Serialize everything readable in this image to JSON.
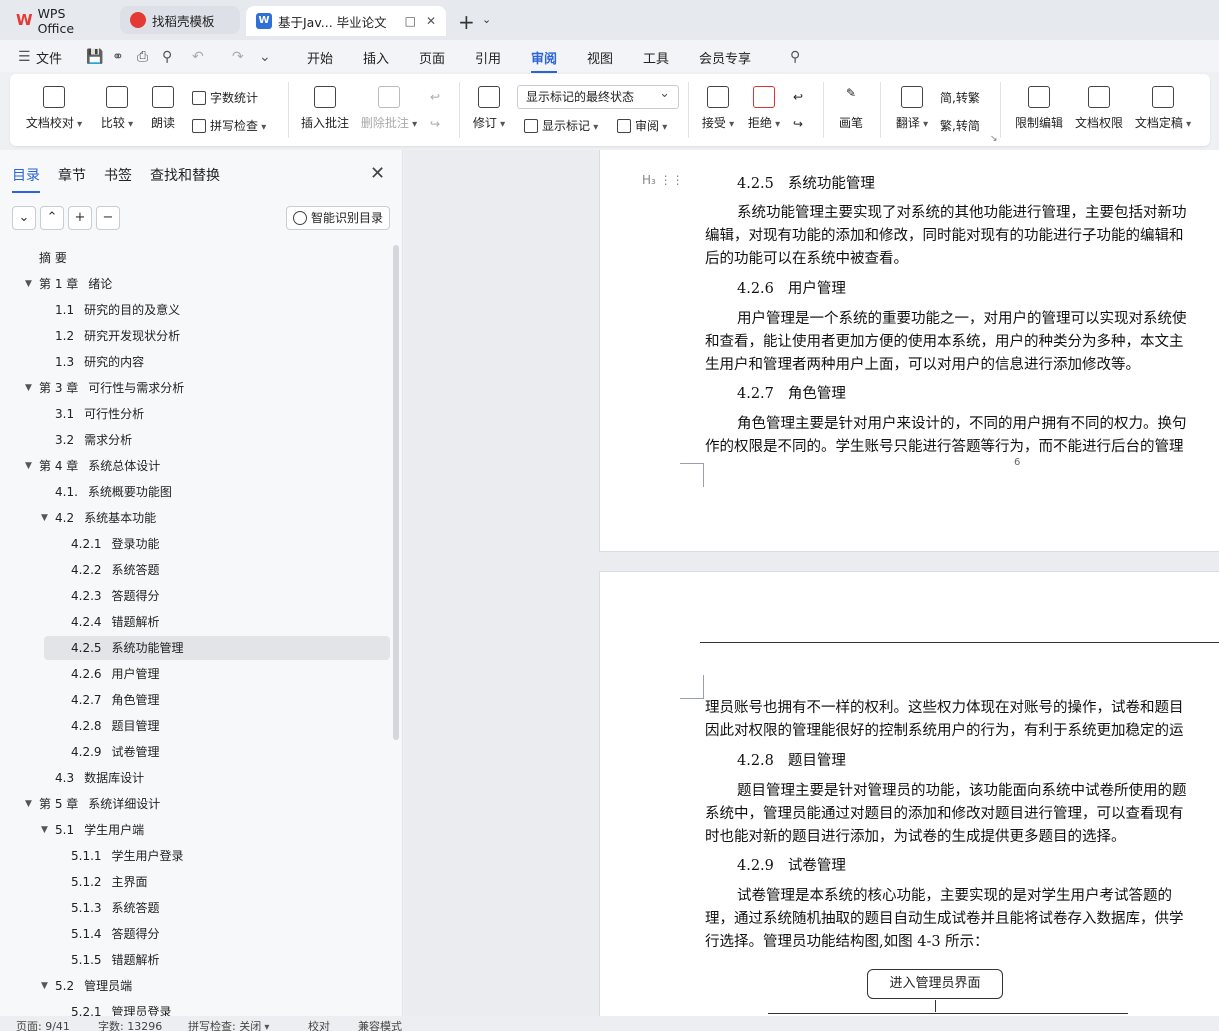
{
  "tabs": {
    "wps": "WPS Office",
    "template": "找稻壳模板",
    "doc": "基于Jav... 毕业论文"
  },
  "menu": {
    "file": "文件",
    "items": [
      "开始",
      "插入",
      "页面",
      "引用",
      "审阅",
      "视图",
      "工具",
      "会员专享"
    ],
    "active": "审阅"
  },
  "ribbon": {
    "doc_check": "文档校对",
    "compare": "比较",
    "read_aloud": "朗读",
    "word_count": "字数统计",
    "spell_check": "拼写检查",
    "insert_comment": "插入批注",
    "delete_comment": "删除批注",
    "revise": "修订",
    "markup_state": "显示标记的最终状态",
    "show_markup": "显示标记",
    "review": "审阅",
    "accept": "接受",
    "reject": "拒绝",
    "pen": "画笔",
    "translate": "翻译",
    "to_traditional": "简,转繁",
    "to_simplified": "繁,转简",
    "restrict_edit": "限制编辑",
    "doc_permission": "文档权限",
    "finalize": "文档定稿"
  },
  "sidebar": {
    "tabs": [
      "目录",
      "章节",
      "书签",
      "查找和替换"
    ],
    "smart_toc": "智能识别目录",
    "toc": [
      {
        "num": "",
        "label": "摘 要"
      },
      {
        "num": "第 1 章",
        "label": "绪论"
      },
      {
        "num": "1.1",
        "label": "研究的目的及意义"
      },
      {
        "num": "1.2",
        "label": "研究开发现状分析"
      },
      {
        "num": "1.3",
        "label": "研究的内容"
      },
      {
        "num": "第 3 章",
        "label": "可行性与需求分析"
      },
      {
        "num": "3.1",
        "label": "可行性分析"
      },
      {
        "num": "3.2",
        "label": "需求分析"
      },
      {
        "num": "第 4 章",
        "label": "系统总体设计"
      },
      {
        "num": "4.1.",
        "label": "系统概要功能图"
      },
      {
        "num": "4.2",
        "label": "系统基本功能"
      },
      {
        "num": "4.2.1",
        "label": "登录功能"
      },
      {
        "num": "4.2.2",
        "label": "系统答题"
      },
      {
        "num": "4.2.3",
        "label": "答题得分"
      },
      {
        "num": "4.2.4",
        "label": "错题解析"
      },
      {
        "num": "4.2.5",
        "label": "系统功能管理"
      },
      {
        "num": "4.2.6",
        "label": "用户管理"
      },
      {
        "num": "4.2.7",
        "label": "角色管理"
      },
      {
        "num": "4.2.8",
        "label": "题目管理"
      },
      {
        "num": "4.2.9",
        "label": "试卷管理"
      },
      {
        "num": "4.3",
        "label": "数据库设计"
      },
      {
        "num": "第 5 章",
        "label": "系统详细设计"
      },
      {
        "num": "5.1",
        "label": "学生用户端"
      },
      {
        "num": "5.1.1",
        "label": "学生用户登录"
      },
      {
        "num": "5.1.2",
        "label": "主界面"
      },
      {
        "num": "5.1.3",
        "label": "系统答题"
      },
      {
        "num": "5.1.4",
        "label": "答题得分"
      },
      {
        "num": "5.1.5",
        "label": "错题解析"
      },
      {
        "num": "5.2",
        "label": "管理员端"
      },
      {
        "num": "5.2.1",
        "label": "管理员登录"
      }
    ]
  },
  "document": {
    "page1": {
      "h1_num": "4.2.5",
      "h1": "系统功能管理",
      "p1": [
        "系统功能管理主要实现了对系统的其他功能进行管理，主要包括对新功",
        "编辑，对现有功能的添加和修改，同时能对现有的功能进行子功能的编辑和",
        "后的功能可以在系统中被查看。"
      ],
      "h2_num": "4.2.6",
      "h2": "用户管理",
      "p2": [
        "用户管理是一个系统的重要功能之一，对用户的管理可以实现对系统使",
        "和查看，能让使用者更加方便的使用本系统，用户的种类分为多种，本文主",
        "生用户和管理者两种用户上面，可以对用户的信息进行添加修改等。"
      ],
      "h3_num": "4.2.7",
      "h3": "角色管理",
      "p3": [
        "角色管理主要是针对用户来设计的，不同的用户拥有不同的权力。换句",
        "作的权限是不同的。学生账号只能进行答题等行为，而不能进行后台的管理"
      ],
      "page_number": "6"
    },
    "page2": {
      "p0": [
        "理员账号也拥有不一样的权利。这些权力体现在对账号的操作，试卷和题目",
        "因此对权限的管理能很好的控制系统用户的行为，有利于系统更加稳定的运"
      ],
      "h1_num": "4.2.8",
      "h1": "题目管理",
      "p1": [
        "题目管理主要是针对管理员的功能，该功能面向系统中试卷所使用的题",
        "系统中，管理员能通过对题目的添加和修改对题目进行管理，可以查看现有",
        "时也能对新的题目进行添加，为试卷的生成提供更多题目的选择。"
      ],
      "h2_num": "4.2.9",
      "h2": "试卷管理",
      "p2": [
        "试卷管理是本系统的核心功能，主要实现的是对学生用户考试答题的",
        "理，通过系统随机抽取的题目自动生成试卷并且能将试卷存入数据库，供学",
        "行选择。管理员功能结构图,如图 4-3 所示："
      ],
      "flow_box": "进入管理员界面"
    }
  },
  "status": {
    "page": "页面: 9/41",
    "words": "字数: 13296",
    "spell": "拼写检查: 关闭",
    "proof": "校对",
    "compat": "兼容模式"
  }
}
